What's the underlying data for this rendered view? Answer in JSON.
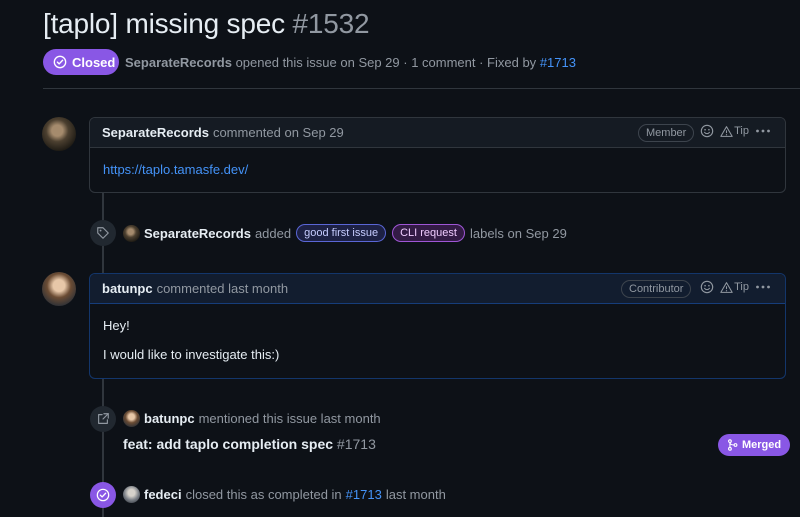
{
  "issue": {
    "title": "[taplo] missing spec",
    "number": "#1532",
    "state": "Closed",
    "author": "SeparateRecords",
    "opened_text": "opened this issue on Sep 29 · 1 comment · Fixed by",
    "fixed_by": "#1713"
  },
  "comments": [
    {
      "author": "SeparateRecords",
      "action": "commented on Sep 29",
      "role": "Member",
      "tip": "Tip",
      "body": [
        "https://taplo.tamasfe.dev/"
      ]
    },
    {
      "author": "batunpc",
      "action": "commented last month",
      "role": "Contributor",
      "tip": "Tip",
      "body": [
        "Hey!",
        "I would like to investigate this:)"
      ]
    }
  ],
  "label_event": {
    "actor": "SeparateRecords",
    "verb": "added",
    "labels": [
      "good first issue",
      "CLI request"
    ],
    "suffix": "labels on Sep 29"
  },
  "mention_event": {
    "actor": "batunpc",
    "text": "mentioned this issue last month",
    "ref_title": "feat: add taplo completion spec",
    "ref_number": "#1713",
    "ref_state": "Merged"
  },
  "close_event": {
    "actor": "fedeci",
    "text": "closed this as completed in",
    "ref": "#1713",
    "suffix": "last month"
  },
  "colors": {
    "background": "#0d1117",
    "closed": "#8957e5",
    "link": "#4493f8"
  }
}
